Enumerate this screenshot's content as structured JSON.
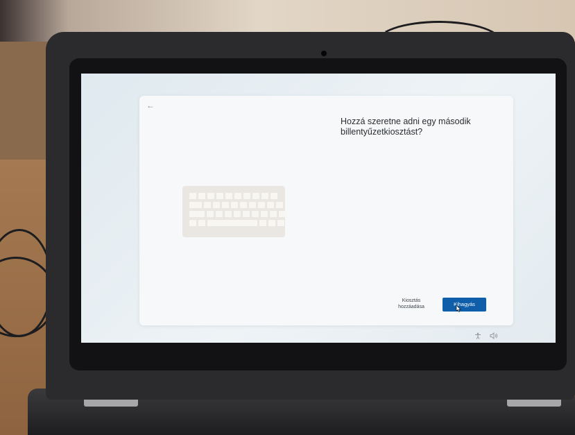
{
  "setup": {
    "title": "Hozzá szeretne adni egy második billentyűzetkiosztást?",
    "add_layout_label": "Kiosztás hozzáadása",
    "skip_label": "Kihagyás"
  },
  "icons": {
    "back": "back-arrow-icon",
    "keyboard": "keyboard-illustration",
    "accessibility": "accessibility-icon",
    "volume": "volume-icon"
  },
  "colors": {
    "primary_button": "#0f5eaa",
    "card": "#f6f8fa"
  }
}
